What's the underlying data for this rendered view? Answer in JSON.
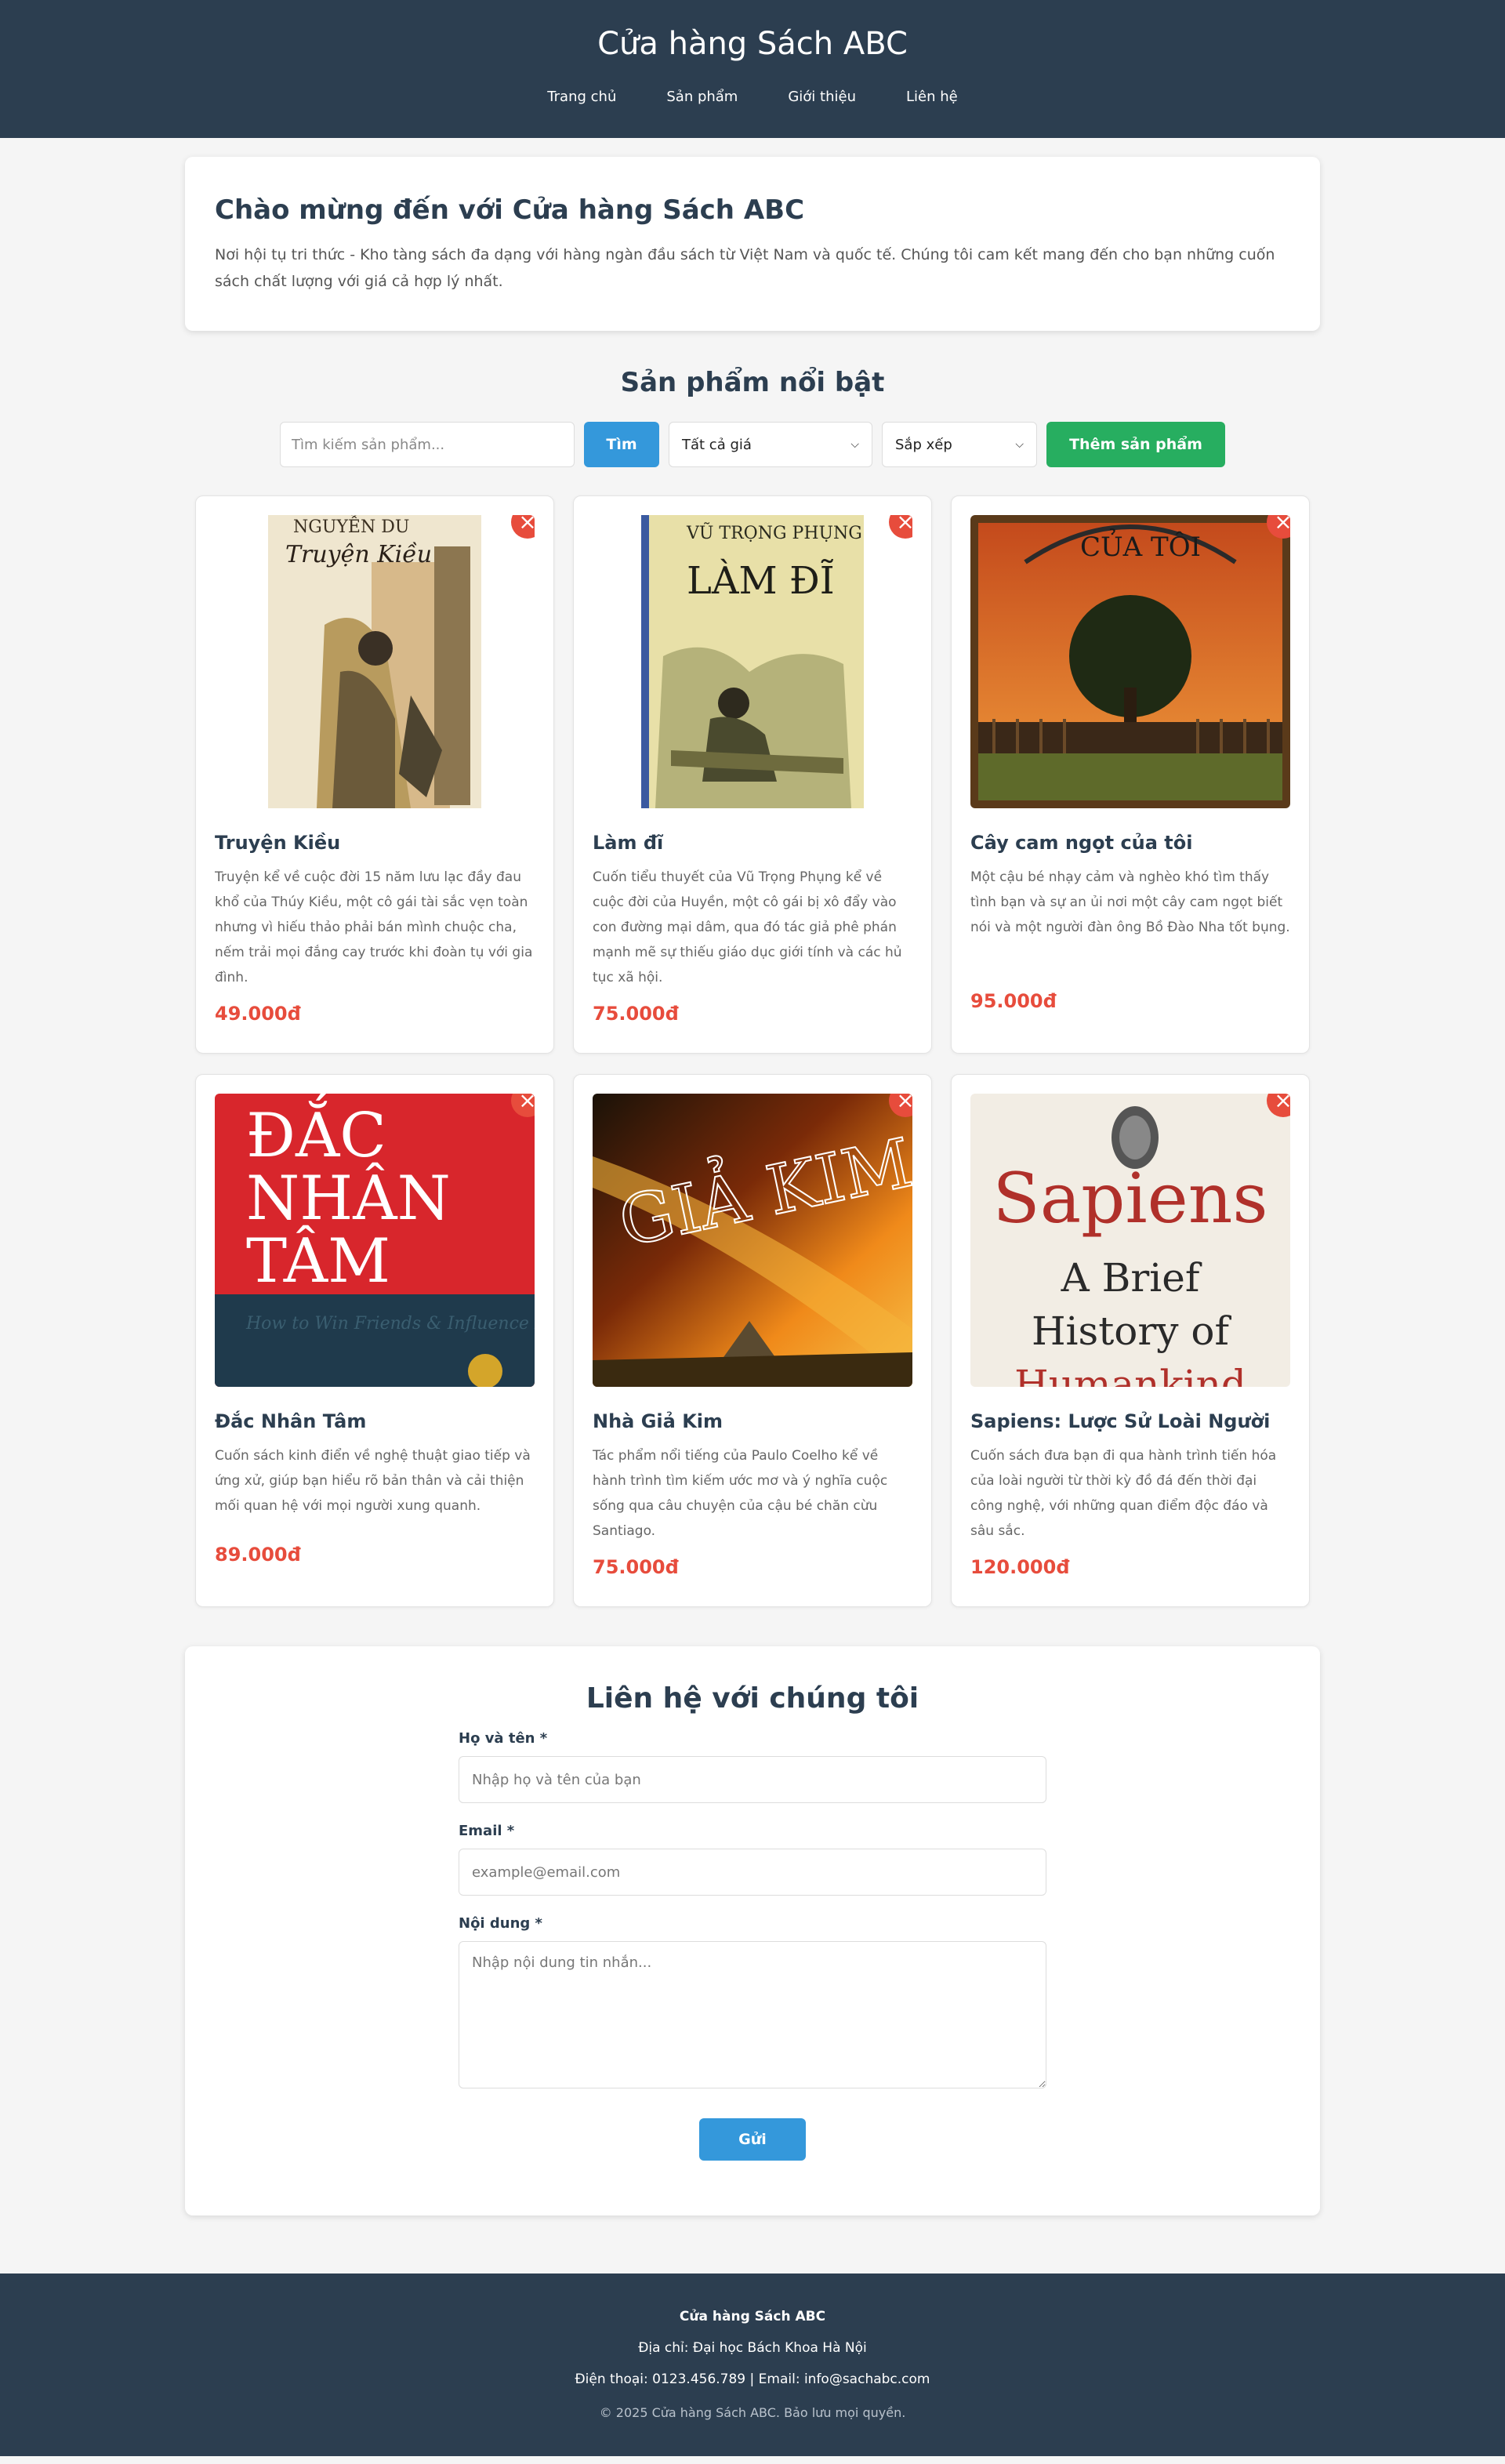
{
  "header": {
    "title": "Cửa hàng Sách ABC",
    "nav": [
      "Trang chủ",
      "Sản phẩm",
      "Giới thiệu",
      "Liên hệ"
    ]
  },
  "welcome": {
    "title": "Chào mừng đến với Cửa hàng Sách ABC",
    "text": "Nơi hội tụ tri thức - Kho tàng sách đa dạng với hàng ngàn đầu sách từ Việt Nam và quốc tế. Chúng tôi cam kết mang đến cho bạn những cuốn sách chất lượng với giá cả hợp lý nhất."
  },
  "products_section": {
    "title": "Sản phẩm nổi bật",
    "search_placeholder": "Tìm kiếm sản phẩm...",
    "search_button": "Tìm",
    "price_filter": "Tất cả giá",
    "sort": "Sắp xếp",
    "add_button": "Thêm sản phẩm",
    "delete_symbol": "×"
  },
  "products": [
    {
      "title": "Truyện Kiều",
      "desc": "Truyện kể về cuộc đời 15 năm lưu lạc đầy đau khổ của Thúy Kiều, một cô gái tài sắc vẹn toàn nhưng vì hiếu thảo phải bán mình chuộc cha, nếm trải mọi đắng cay trước khi đoàn tụ với gia đình.",
      "price": "49.000đ",
      "cover": {
        "author": "NGUYỄN DU",
        "title": "Truyện Kiều"
      }
    },
    {
      "title": "Làm đĩ",
      "desc": "Cuốn tiểu thuyết của Vũ Trọng Phụng kể về cuộc đời của Huyền, một cô gái bị xô đẩy vào con đường mại dâm, qua đó tác giả phê phán mạnh mẽ sự thiếu giáo dục giới tính và các hủ tục xã hội.",
      "price": "75.000đ",
      "cover": {
        "author": "VŨ TRỌNG PHỤNG",
        "title": "LÀM ĐĨ"
      }
    },
    {
      "title": "Cây cam ngọt của tôi",
      "desc": "Một cậu bé nhạy cảm và nghèo khó tìm thấy tình bạn và sự an ủi nơi một cây cam ngọt biết nói và một người đàn ông Bồ Đào Nha tốt bụng.",
      "price": "95.000đ",
      "cover": {
        "title": "CỦA TÔI"
      }
    },
    {
      "title": "Đắc Nhân Tâm",
      "desc": "Cuốn sách kinh điển về nghệ thuật giao tiếp và ứng xử, giúp bạn hiểu rõ bản thân và cải thiện mối quan hệ với mọi người xung quanh.",
      "price": "89.000đ",
      "cover": {
        "line1": "ĐẮC",
        "line2": "NHÂN",
        "line3": "TÂM",
        "subtitle": "How to Win Friends & Influence People"
      }
    },
    {
      "title": "Nhà Giả Kim",
      "desc": "Tác phẩm nổi tiếng của Paulo Coelho kể về hành trình tìm kiếm ước mơ và ý nghĩa cuộc sống qua câu chuyện của cậu bé chăn cừu Santiago.",
      "price": "75.000đ",
      "cover": {
        "title": "GIẢ KIM"
      }
    },
    {
      "title": "Sapiens: Lược Sử Loài Người",
      "desc": "Cuốn sách đưa bạn đi qua hành trình tiến hóa của loài người từ thời kỳ đồ đá đến thời đại công nghệ, với những quan điểm độc đáo và sâu sắc.",
      "price": "120.000đ",
      "cover": {
        "title": "Sapiens",
        "line1": "A Brief",
        "line2": "History of",
        "line3": "Humankind"
      }
    }
  ],
  "contact": {
    "title": "Liên hệ với chúng tôi",
    "name_label": "Họ và tên *",
    "name_placeholder": "Nhập họ và tên của bạn",
    "email_label": "Email *",
    "email_placeholder": "example@email.com",
    "message_label": "Nội dung *",
    "message_placeholder": "Nhập nội dung tin nhắn...",
    "submit": "Gửi"
  },
  "footer": {
    "title": "Cửa hàng Sách ABC",
    "address": "Địa chỉ: Đại học Bách Khoa Hà Nội",
    "contact": "Điện thoại: 0123.456.789 | Email: info@sachabc.com",
    "copyright": "© 2025 Cửa hàng Sách ABC. Bảo lưu mọi quyền."
  },
  "colors": {
    "header_bg": "#2c3e50",
    "primary": "#3498db",
    "success": "#27ae60",
    "danger": "#e74c3c"
  }
}
